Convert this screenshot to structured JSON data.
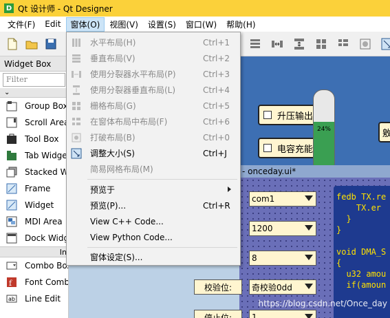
{
  "window": {
    "title": "Qt 设计师 - Qt Designer",
    "app_icon_letter": "D"
  },
  "menubar": {
    "items": [
      {
        "label": "文件(F)"
      },
      {
        "label": "Edit"
      },
      {
        "label": "窗体(O)"
      },
      {
        "label": "视图(V)"
      },
      {
        "label": "设置(S)"
      },
      {
        "label": "窗口(W)"
      },
      {
        "label": "帮助(H)"
      }
    ]
  },
  "form_menu": {
    "items": [
      {
        "label": "水平布局(H)",
        "shortcut": "Ctrl+1",
        "enabled": false
      },
      {
        "label": "垂直布局(V)",
        "shortcut": "Ctrl+2",
        "enabled": false
      },
      {
        "label": "使用分裂器水平布局(P)",
        "shortcut": "Ctrl+3",
        "enabled": false
      },
      {
        "label": "使用分裂器垂直布局(L)",
        "shortcut": "Ctrl+4",
        "enabled": false
      },
      {
        "label": "栅格布局(G)",
        "shortcut": "Ctrl+5",
        "enabled": false
      },
      {
        "label": "在窗体布局中布局(F)",
        "shortcut": "Ctrl+6",
        "enabled": false
      },
      {
        "label": "打破布局(B)",
        "shortcut": "Ctrl+0",
        "enabled": false
      },
      {
        "label": "调整大小(S)",
        "shortcut": "Ctrl+J",
        "enabled": true
      },
      {
        "label": "简易网格布局(M)",
        "shortcut": "",
        "enabled": false
      },
      {
        "label": "预览于",
        "shortcut": "",
        "enabled": true,
        "submenu": true
      },
      {
        "label": "预览(P)...",
        "shortcut": "Ctrl+R",
        "enabled": true
      },
      {
        "label": "View C++ Code...",
        "shortcut": "",
        "enabled": true
      },
      {
        "label": "View Python Code...",
        "shortcut": "",
        "enabled": true
      },
      {
        "label": "窗体设定(S)...",
        "shortcut": "",
        "enabled": true
      }
    ]
  },
  "widget_box": {
    "title": "Widget Box",
    "filter_placeholder": "Filter",
    "containers_label": "",
    "items": [
      {
        "label": "Group Box"
      },
      {
        "label": "Scroll Area"
      },
      {
        "label": "Tool Box"
      },
      {
        "label": "Tab Widget"
      },
      {
        "label": "Stacked Widget"
      },
      {
        "label": "Frame"
      },
      {
        "label": "Widget"
      },
      {
        "label": "MDI Area"
      },
      {
        "label": "Dock Widget"
      }
    ],
    "input_category": "In",
    "input_items": [
      {
        "label": "Combo Box"
      },
      {
        "label": "Font Combo Box"
      },
      {
        "label": "Line Edit"
      }
    ]
  },
  "canvas": {
    "button_boost": "升压输出",
    "button_capacitor": "电容充能",
    "gauge_text": "24%",
    "gauge_level": 0.58,
    "side_label": "敫",
    "subwindow_title": "- onceday.ui*",
    "combo_values": [
      "com1",
      "1200",
      "8",
      "奇校验0dd",
      "1"
    ],
    "parity_label": "校验位:",
    "stopbit_label": "停止位:",
    "code_lines": [
      "fedb TX.re",
      "    TX.er",
      "  }",
      "}",
      "",
      "void DMA_S",
      "{",
      "  u32 amou",
      "  if(amoun"
    ],
    "watermark": "https://blog.csdn.net/Once_day"
  }
}
